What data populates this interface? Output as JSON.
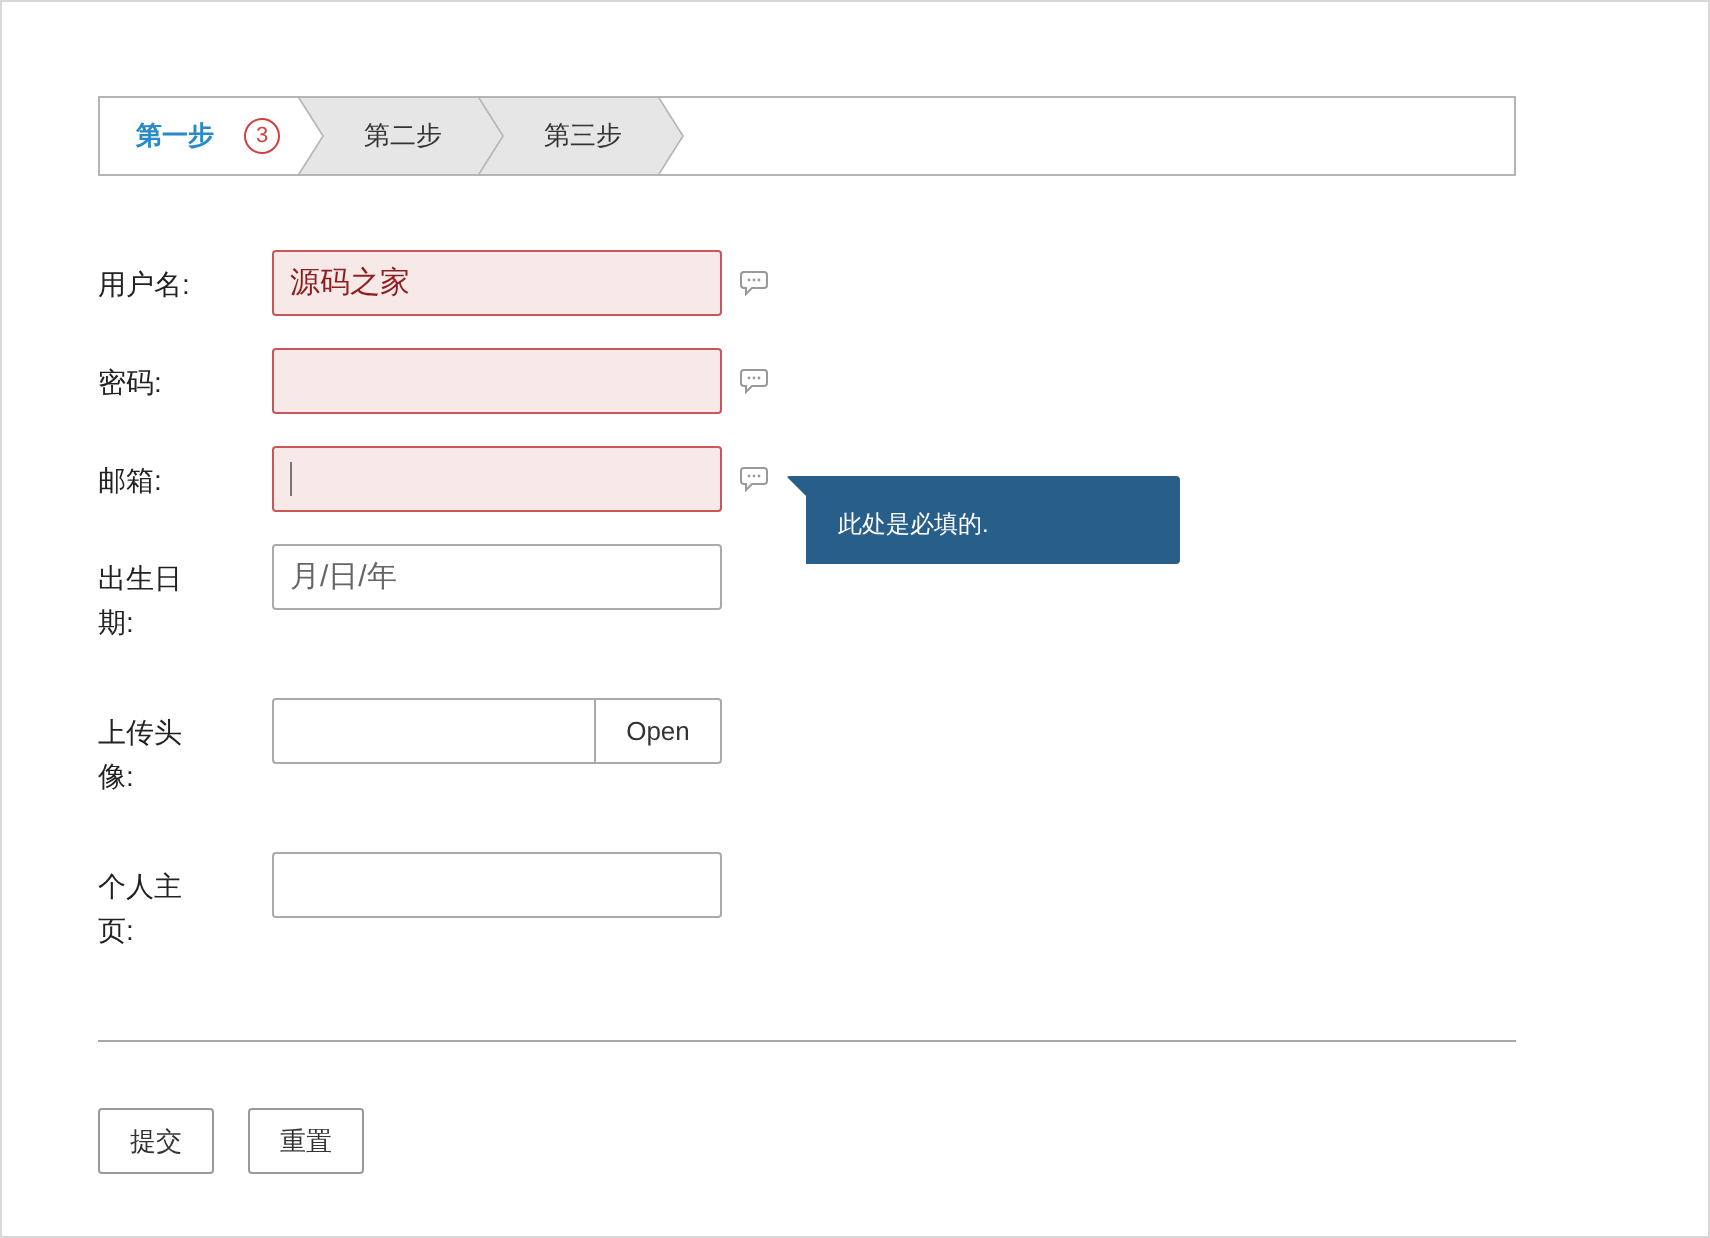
{
  "steps": [
    {
      "label": "第一步",
      "selected": true,
      "badge": "3"
    },
    {
      "label": "第二步",
      "selected": false
    },
    {
      "label": "第三步",
      "selected": false
    }
  ],
  "fields": [
    {
      "kind": "text",
      "label": "用户名:",
      "value": "源码之家",
      "invalid": true,
      "focused": false,
      "help_icon": true
    },
    {
      "kind": "text",
      "label": "密码:",
      "invalid": true,
      "focused": false,
      "help_icon": true
    },
    {
      "kind": "text",
      "label": "邮箱:",
      "invalid": true,
      "focused": true,
      "help_icon": true,
      "tooltip": "此处是必填的."
    },
    {
      "kind": "date",
      "label": "出生日期:",
      "placeholder": "月/日/年",
      "invalid": false,
      "focused": false,
      "help_icon": false
    },
    {
      "kind": "file",
      "label": "上传头像:",
      "button": "Open",
      "invalid": false,
      "focused": false,
      "help_icon": false
    },
    {
      "kind": "text",
      "label": "个人主页:",
      "invalid": false,
      "focused": false,
      "help_icon": false
    }
  ],
  "buttons": [
    "提交",
    "重置"
  ]
}
